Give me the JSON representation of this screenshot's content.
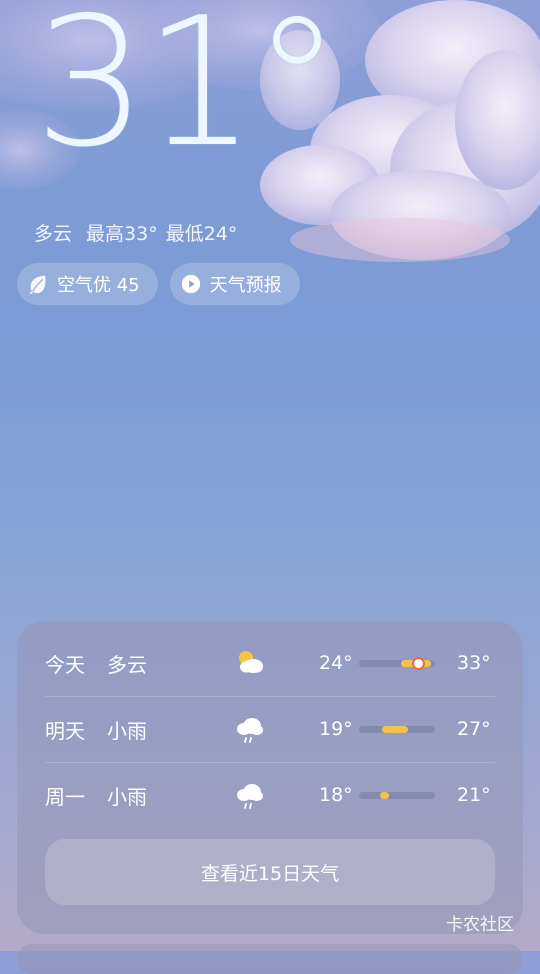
{
  "current": {
    "temperature": "31°",
    "condition": "多云",
    "high": "最高33°",
    "low": "最低24°"
  },
  "chips": {
    "air_quality": "空气优 45",
    "forecast_video": "天气预报"
  },
  "forecast": [
    {
      "day": "今天",
      "condition": "多云",
      "icon": "partly-cloudy-icon",
      "low": "24°",
      "high": "33°",
      "range_start": 0.55,
      "range_end": 0.95,
      "current_marker": 0.78
    },
    {
      "day": "明天",
      "condition": "小雨",
      "icon": "light-rain-icon",
      "low": "19°",
      "high": "27°",
      "range_start": 0.3,
      "range_end": 0.65
    },
    {
      "day": "周一",
      "condition": "小雨",
      "icon": "light-rain-icon",
      "low": "18°",
      "high": "21°",
      "range_start": 0.27,
      "range_end": 0.4
    }
  ],
  "more_button": "查看近15日天气",
  "watermark": "卡农社区",
  "colors": {
    "bar_fill": "#f2c24f",
    "current_marker_ring": "#e86a4a"
  }
}
